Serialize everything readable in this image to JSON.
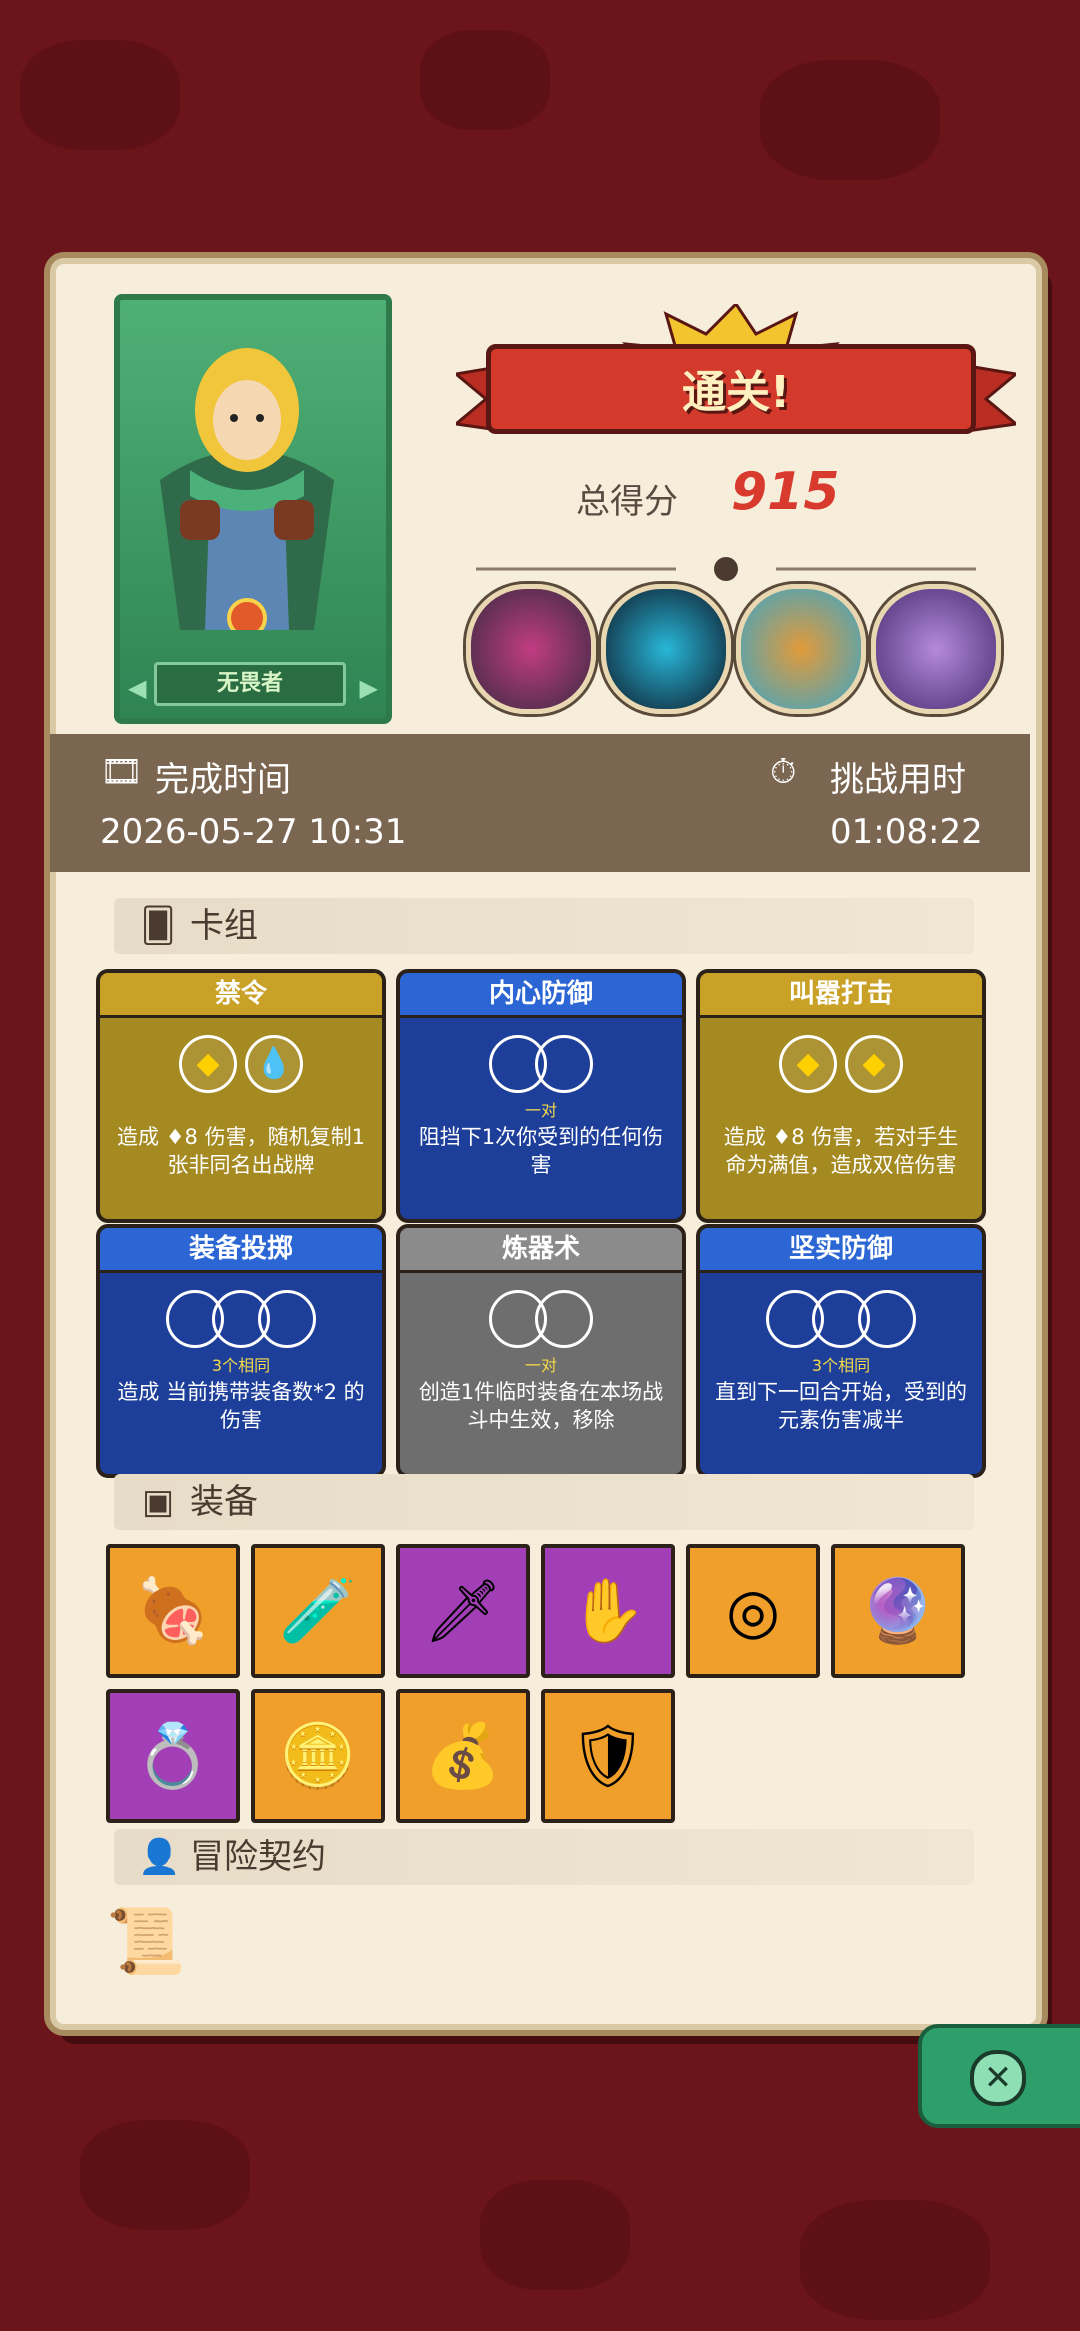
{
  "hero": {
    "name": "无畏者"
  },
  "result": {
    "banner": "通关!",
    "score_label": "总得分",
    "score": "915"
  },
  "stats": {
    "finish_label": "完成时间",
    "finish_value": "2026-05-27 10:31",
    "duration_label": "挑战用时",
    "duration_value": "01:08:22"
  },
  "sections": {
    "deck": "卡组",
    "equipment": "装备",
    "contract": "冒险契约"
  },
  "cards": [
    {
      "title": "禁令",
      "color": "gold",
      "sub": "",
      "desc": "造成 ♦8 伤害，随机复制1张非同名出战牌"
    },
    {
      "title": "内心防御",
      "color": "blue",
      "sub": "一对",
      "desc": "阻挡下1次你受到的任何伤害"
    },
    {
      "title": "叫嚣打击",
      "color": "gold",
      "sub": "",
      "desc": "造成 ♦8 伤害，若对手生命为满值，造成双倍伤害"
    },
    {
      "title": "装备投掷",
      "color": "blue",
      "sub": "3个相同",
      "desc": "造成 当前携带装备数*2 的伤害"
    },
    {
      "title": "炼器术",
      "color": "gray",
      "sub": "一对",
      "desc": "创造1件临时装备在本场战斗中生效，移除"
    },
    {
      "title": "坚实防御",
      "color": "blue",
      "sub": "3个相同",
      "desc": "直到下一回合开始，受到的元素伤害减半"
    }
  ],
  "items": [
    {
      "icon": "meat-icon",
      "glyph": "🍖",
      "color": "#f0a02a"
    },
    {
      "icon": "potion-jar-icon",
      "glyph": "🧪",
      "color": "#f0a02a"
    },
    {
      "icon": "red-dagger-icon",
      "glyph": "🗡",
      "color": "#a33fb6"
    },
    {
      "icon": "glove-icon",
      "glyph": "✋",
      "color": "#a33fb6"
    },
    {
      "icon": "round-shield-icon",
      "glyph": "◎",
      "color": "#f0a02a"
    },
    {
      "icon": "blue-orb-wand-icon",
      "glyph": "🔮",
      "color": "#f0a02a"
    },
    {
      "icon": "ring-icon",
      "glyph": "💍",
      "color": "#a33fb6"
    },
    {
      "icon": "coin-icon",
      "glyph": "🪙",
      "color": "#f0a02a"
    },
    {
      "icon": "sack-icon",
      "glyph": "💰",
      "color": "#f0a02a"
    },
    {
      "icon": "ice-shield-icon",
      "glyph": "🛡",
      "color": "#f0a02a"
    }
  ],
  "colors": {
    "gold": "#a58a22",
    "gold_title": "#c9a127",
    "blue": "#1d3f9a",
    "blue_title": "#2b66d4",
    "gray": "#6e6e6e",
    "gray_title": "#8b8b8b"
  }
}
